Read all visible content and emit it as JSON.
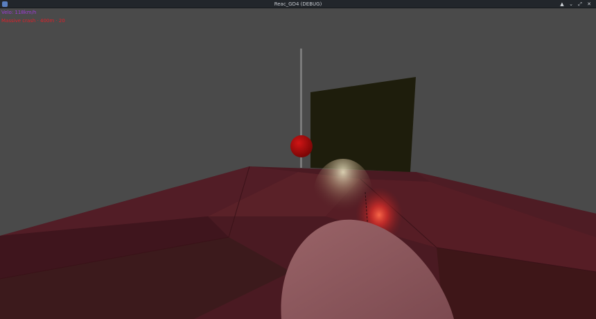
{
  "window": {
    "title": "Reac_GD4 (DEBUG)",
    "controls": {
      "keep_above": "▲",
      "minimize": "⌄",
      "maximize": "⤢",
      "close": "✕"
    }
  },
  "hud": {
    "velocity": "Velo: 118km/h",
    "status": "Massive crash · 400m · 20"
  },
  "colors": {
    "sky": "#4a4a4a",
    "floor": "#4a1a22",
    "wall": "#1e1d0c",
    "ball": "#a00a0a",
    "velo_text": "#9d3cd6",
    "status_text": "#e0202a"
  }
}
